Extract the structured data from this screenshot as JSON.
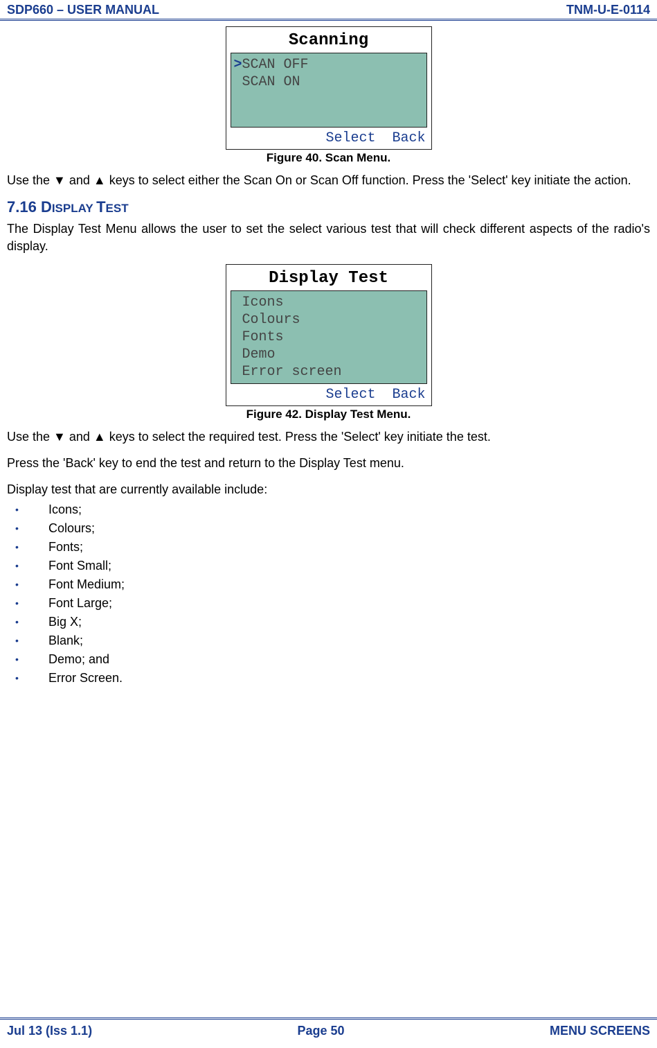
{
  "header": {
    "left": "SDP660 – USER MANUAL",
    "right": "TNM-U-E-0114"
  },
  "footer": {
    "left": "Jul 13 (Iss 1.1)",
    "center": "Page 50",
    "right": "MENU SCREENS"
  },
  "screen1": {
    "title": "Scanning",
    "line1_caret": ">",
    "line1": "SCAN OFF",
    "line2": " SCAN ON",
    "select": "Select",
    "back": "Back"
  },
  "fig40": "Figure 40.  Scan Menu.",
  "para1": "Use the ▼ and ▲ keys to select either the Scan On or Scan Off function.  Press the 'Select' key initiate the action.",
  "sec716_num": "7.16  ",
  "sec716_title_small": "D",
  "sec716_title_rest": "ISPLAY ",
  "sec716_title_small2": "T",
  "sec716_title_rest2": "EST",
  "para2": "The Display Test Menu allows the user to set the select various test that will check different aspects of the radio's display.",
  "screen2": {
    "title": "Display Test",
    "line1": " Icons",
    "line2": " Colours",
    "line3": " Fonts",
    "line4": " Demo",
    "line5": " Error screen",
    "select": "Select",
    "back": "Back"
  },
  "fig42": "Figure 42.  Display Test Menu.",
  "para3": "Use the ▼ and ▲ keys to select the required test.  Press the 'Select' key initiate the test.",
  "para4": "Press the 'Back' key to end the test and return to the Display Test menu.",
  "para5": "Display test that are currently available include:",
  "bullets": {
    "b1": "Icons;",
    "b2": "Colours;",
    "b3": "Fonts;",
    "b4": "Font Small;",
    "b5": "Font Medium;",
    "b6": "Font Large;",
    "b7": "Big X;",
    "b8": "Blank;",
    "b9": "Demo; and",
    "b10": "Error Screen."
  }
}
